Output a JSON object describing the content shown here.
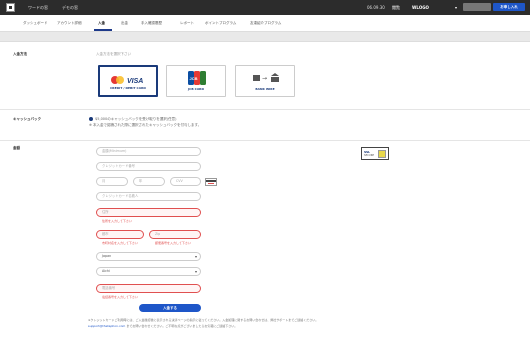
{
  "topbar": {
    "nav_links": [
      "ワードの窓",
      "デモの窓"
    ],
    "date": "06.09.30",
    "nav_right": "閲覧",
    "user": "WLOGO",
    "user_chevron": "▾",
    "action_button": "お申し入れ"
  },
  "nav": {
    "tabs": [
      "ダッシュボード",
      "アカウント詳細",
      "入金",
      "出金",
      "手入確認履歴",
      "レポート",
      "ポイントプログラム",
      "友達紹介プログラム"
    ]
  },
  "payment_method": {
    "label": "入金方法",
    "hint": "入金方法を選択下さい",
    "cards": [
      {
        "caption": "CREDIT / DEBIT CARD",
        "logo_text": "VISA"
      },
      {
        "caption": "JCB CARD",
        "logo_text": "JCB"
      },
      {
        "caption": "BANK WIRE",
        "logo_text": "→"
      }
    ]
  },
  "cashback": {
    "label": "キャッシュバック",
    "line1": "$5,000のキャッシュバックを受け取りを選択(任意)",
    "line2": "※ 本入金で認識された際に選択されたキャッシュバックを付与します。"
  },
  "amount": {
    "label": "金額",
    "fields": {
      "amount": "金額(Minimum)",
      "card_number": "クレジットカード番号",
      "month": "月",
      "year": "年",
      "cvv": "CVV",
      "card_name": "クレジットカード名義人",
      "address": "住所",
      "address_error": "住所を入力して下さい",
      "city": "都市",
      "city_error": "市町村名を入力して下さい",
      "zip": "Zip",
      "zip_error": "郵便番号を入力して下さい",
      "country": "Japan",
      "state": "Aichi",
      "phone": "電話番号",
      "phone_error": "電話番号を入力して下さい"
    },
    "badge": {
      "title": "SSL",
      "sub": "SECURE"
    }
  },
  "submit_label": "入金する",
  "footer": {
    "line1": "※クレジットカードご利用時には、ご入金確認後に表示される決済ページの指示に従ってください。入金処理に関するお問い合わせは、弊社サポートまでご連絡ください。",
    "email": "support@thetaphon.com",
    "line2": "までお問い合わせください。ご不明な点がございましたらお気軽にご連絡下さい。"
  }
}
